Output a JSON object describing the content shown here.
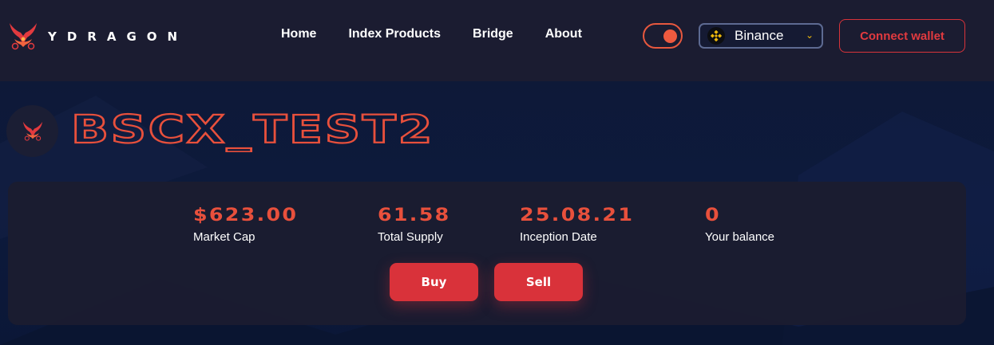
{
  "brand": {
    "name": "YDRAGON"
  },
  "nav": {
    "links": [
      "Home",
      "Index Products",
      "Bridge",
      "About"
    ]
  },
  "network": {
    "selected": "Binance",
    "icon": "binance-icon",
    "accent": "#f0b90b"
  },
  "connect": {
    "label": "Connect wallet"
  },
  "token": {
    "name": "BSCX_TEST2"
  },
  "stats": [
    {
      "value": "$623.00",
      "label": "Market Cap"
    },
    {
      "value": "61.58",
      "label": "Total Supply"
    },
    {
      "value": "25.08.21",
      "label": "Inception Date"
    },
    {
      "value": "0",
      "label": "Your balance"
    }
  ],
  "actions": {
    "buy": "Buy",
    "sell": "Sell"
  },
  "colors": {
    "accent": "#e8503c",
    "button": "#d9323a",
    "navbar": "#1b1c31",
    "background": "#0e1836"
  }
}
